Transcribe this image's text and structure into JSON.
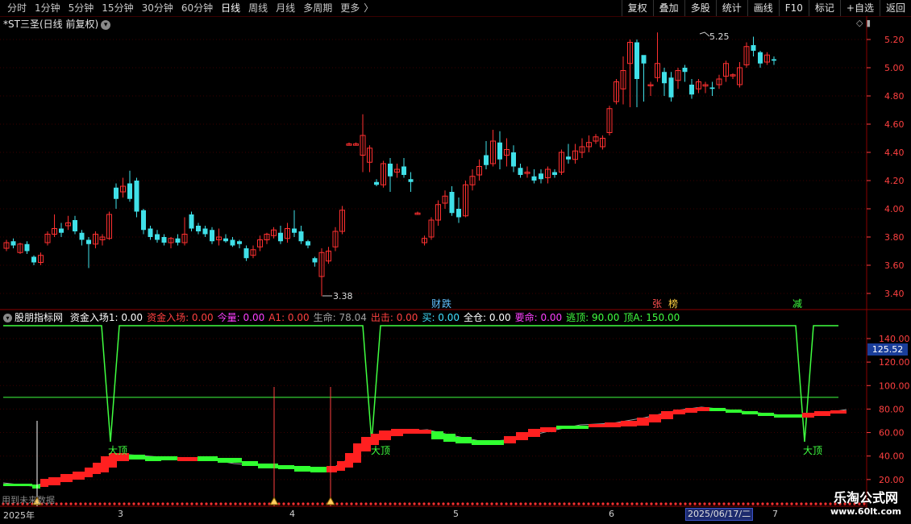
{
  "toolbar": {
    "periods": [
      "分时",
      "1分钟",
      "5分钟",
      "15分钟",
      "30分钟",
      "60分钟",
      "日线",
      "周线",
      "月线",
      "多周期",
      "更多"
    ],
    "active_period": "日线",
    "more_arrow": "〉",
    "right_buttons": [
      "复权",
      "叠加",
      "多股",
      "统计",
      "画线",
      "F10",
      "标记",
      "+自选",
      "返回"
    ]
  },
  "main_chart": {
    "title": "*ST三圣(日线 前复权)",
    "corner_icons": "◇ ▮",
    "high_label": "5.25",
    "low_label": "3.38",
    "y_ticks": [
      "5.20",
      "5.00",
      "4.80",
      "4.60",
      "4.40",
      "4.20",
      "4.00",
      "3.80",
      "3.60",
      "3.40"
    ],
    "markers": [
      {
        "text": "财",
        "color": "#60c0ff"
      },
      {
        "text": "跌",
        "color": "#60c0ff"
      },
      {
        "text": "张",
        "color": "#ff5050"
      },
      {
        "text": "榜",
        "color": "#ffd040"
      },
      {
        "text": "减",
        "color": "#40ff40"
      }
    ]
  },
  "indicator": {
    "name": "股朋指标网",
    "fields": [
      {
        "label": "资金入场1: 0.00",
        "color": "#ffffff"
      },
      {
        "label": "资金入场: 0.00",
        "color": "#ff4040"
      },
      {
        "label": "今量: 0.00",
        "color": "#ff40ff"
      },
      {
        "label": "A1: 0.00",
        "color": "#ff4040"
      },
      {
        "label": "生命: 78.04",
        "color": "#a0a0a0"
      },
      {
        "label": "出击: 0.00",
        "color": "#ff4040"
      },
      {
        "label": "买: 0.00",
        "color": "#40e0ff"
      },
      {
        "label": "全仓: 0.00",
        "color": "#ffffff"
      },
      {
        "label": "要命: 0.00",
        "color": "#ff40ff"
      },
      {
        "label": "逃顶: 90.00",
        "color": "#40ff40"
      },
      {
        "label": "顶A: 150.00",
        "color": "#40ff40"
      }
    ],
    "y_ticks": [
      "140.00",
      "120.00",
      "100.00",
      "80.00",
      "60.00",
      "40.00",
      "20.00"
    ],
    "current_value": "125.52",
    "top_labels": [
      "大顶",
      "大顶",
      "大顶"
    ]
  },
  "footer": {
    "hint": "用到未来数据",
    "dates": [
      "2025年",
      "3",
      "4",
      "5",
      "6",
      "7"
    ],
    "date_box": "2025/06/17/二",
    "watermark_title": "乐淘公式网",
    "watermark_url": "www.60lt.com"
  },
  "colors": {
    "up": "#ff3030",
    "down": "#40e0e8",
    "green": "#40ff40",
    "grid": "#3a0000"
  }
}
